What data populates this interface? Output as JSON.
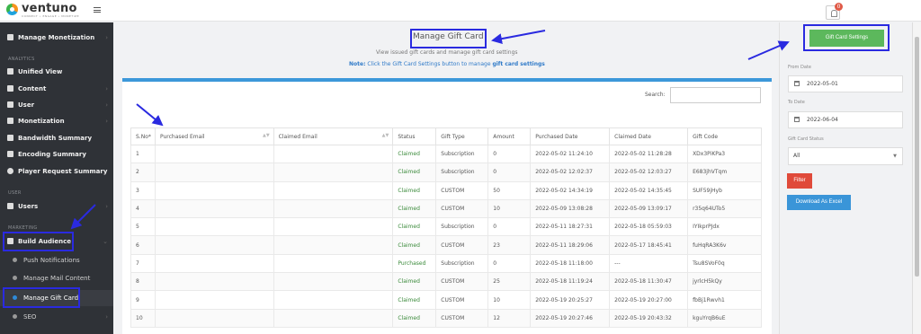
{
  "brand": {
    "name": "ventuno",
    "tagline": "CONNECT • ENGAGE • MONETIZE"
  },
  "notifications": {
    "count": "0"
  },
  "sidebar": {
    "top_item": {
      "label": "Manage Monetization",
      "icon": "dollar-icon"
    },
    "section_analytics": "ANALYTICS",
    "analytics_items": [
      {
        "label": "Unified View",
        "icon": "chart-icon"
      },
      {
        "label": "Content",
        "icon": "document-icon"
      },
      {
        "label": "User",
        "icon": "user-icon"
      },
      {
        "label": "Monetization",
        "icon": "check-square-icon"
      },
      {
        "label": "Bandwidth Summary",
        "icon": "arrows-icon"
      },
      {
        "label": "Encoding Summary",
        "icon": "chart-icon"
      },
      {
        "label": "Player Request Summary",
        "icon": "play-icon"
      }
    ],
    "section_user": "USER",
    "users_item": {
      "label": "Users",
      "icon": "user-icon"
    },
    "section_marketing": "MARKETING",
    "build_audience": {
      "label": "Build Audience",
      "icon": "audience-icon"
    },
    "sub_items": [
      {
        "label": "Push Notifications"
      },
      {
        "label": "Manage Mail Content"
      },
      {
        "label": "Manage Gift Card"
      }
    ],
    "seo_item": {
      "label": "SEO"
    }
  },
  "main": {
    "title": "Manage Gift Card",
    "subtitle": "View issued gift cards and manage gift card settings",
    "note_prefix": "Note:",
    "note_text": " Click the Gift Card Settings button to manage ",
    "note_link": "gift card settings",
    "search_label": "Search:",
    "search_value": "",
    "columns": [
      "S.No*",
      "Purchased Email",
      "Claimed Email",
      "Status",
      "Gift Type",
      "Amount",
      "Purchased Date",
      "Claimed Date",
      "Gift Code"
    ],
    "rows": [
      {
        "sno": "1",
        "purchased_email": "",
        "claimed_email": "",
        "status": "Claimed",
        "gift_type": "Subscription",
        "amount": "0",
        "purchased_date": "2022-05-02 11:24:10",
        "claimed_date": "2022-05-02 11:28:28",
        "code": "XDx3PiKPa3"
      },
      {
        "sno": "2",
        "purchased_email": "",
        "claimed_email": "",
        "status": "Claimed",
        "gift_type": "Subscription",
        "amount": "0",
        "purchased_date": "2022-05-02 12:02:37",
        "claimed_date": "2022-05-02 12:03:27",
        "code": "E683jhVTqm"
      },
      {
        "sno": "3",
        "purchased_email": "",
        "claimed_email": "",
        "status": "Claimed",
        "gift_type": "CUSTOM",
        "amount": "50",
        "purchased_date": "2022-05-02 14:34:19",
        "claimed_date": "2022-05-02 14:35:45",
        "code": "SUF59jHyb"
      },
      {
        "sno": "4",
        "purchased_email": "",
        "claimed_email": "",
        "status": "Claimed",
        "gift_type": "CUSTOM",
        "amount": "10",
        "purchased_date": "2022-05-09 13:08:28",
        "claimed_date": "2022-05-09 13:09:17",
        "code": "r35q64UTo5"
      },
      {
        "sno": "5",
        "purchased_email": "",
        "claimed_email": "",
        "status": "Claimed",
        "gift_type": "Subscription",
        "amount": "0",
        "purchased_date": "2022-05-11 18:27:31",
        "claimed_date": "2022-05-18 05:59:03",
        "code": "IYIkprPJdx"
      },
      {
        "sno": "6",
        "purchased_email": "",
        "claimed_email": "",
        "status": "Claimed",
        "gift_type": "CUSTOM",
        "amount": "23",
        "purchased_date": "2022-05-11 18:29:06",
        "claimed_date": "2022-05-17 18:45:41",
        "code": "fuHqRA3K6v"
      },
      {
        "sno": "7",
        "purchased_email": "",
        "claimed_email": "",
        "status": "Purchased",
        "gift_type": "Subscription",
        "amount": "0",
        "purchased_date": "2022-05-18 11:18:00",
        "claimed_date": "---",
        "code": "Tsu8SVoF0q"
      },
      {
        "sno": "8",
        "purchased_email": "",
        "claimed_email": "",
        "status": "Claimed",
        "gift_type": "CUSTOM",
        "amount": "25",
        "purchased_date": "2022-05-18 11:19:24",
        "claimed_date": "2022-05-18 11:30:47",
        "code": "jyrlcH5kQy"
      },
      {
        "sno": "9",
        "purchased_email": "",
        "claimed_email": "",
        "status": "Claimed",
        "gift_type": "CUSTOM",
        "amount": "10",
        "purchased_date": "2022-05-19 20:25:27",
        "claimed_date": "2022-05-19 20:27:00",
        "code": "fbBj1Rwvh1"
      },
      {
        "sno": "10",
        "purchased_email": "",
        "claimed_email": "",
        "status": "Claimed",
        "gift_type": "CUSTOM",
        "amount": "12",
        "purchased_date": "2022-05-19 20:27:46",
        "claimed_date": "2022-05-19 20:43:32",
        "code": "kguYrqB6uE"
      }
    ]
  },
  "right_panel": {
    "settings_button": "Gift Card Settings",
    "from_label": "From Date",
    "from_value": "2022-05-01",
    "to_label": "To Date",
    "to_value": "2022-06-04",
    "status_label": "Gift Card Status",
    "status_value": "All",
    "filter_button": "Filter",
    "excel_button": "Download As Excel"
  },
  "colors": {
    "accent_blue": "#3c98d9",
    "success_green": "#5cb85c",
    "danger_red": "#e04a3a",
    "annotation_blue": "#2a2ae0",
    "sidebar_bg": "#2f3237"
  }
}
